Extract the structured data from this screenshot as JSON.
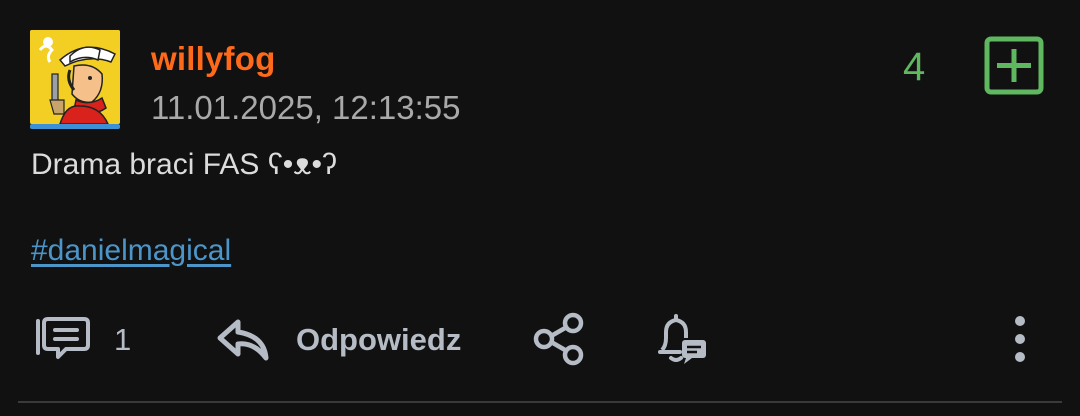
{
  "post": {
    "author": "willyfog",
    "timestamp": "11.01.2025, 12:13:55",
    "votes": "4",
    "text": "Drama braci FAS ʕ•ᴥ•ʔ",
    "tag": "#danielmagical"
  },
  "actions": {
    "comment_count": "1",
    "reply_label": "Odpowiedz"
  },
  "icons": {
    "avatar": "cowboy-avatar",
    "plus": "plus-square-icon",
    "comment": "comment-icon",
    "reply": "reply-arrow-icon",
    "share": "share-icon",
    "notify": "bell-message-icon",
    "more": "more-vertical-icon"
  },
  "colors": {
    "background": "#111111",
    "username": "#ff6a1a",
    "vote_green": "#5fb860",
    "link": "#4c95c8",
    "muted": "#a9a9a9"
  }
}
